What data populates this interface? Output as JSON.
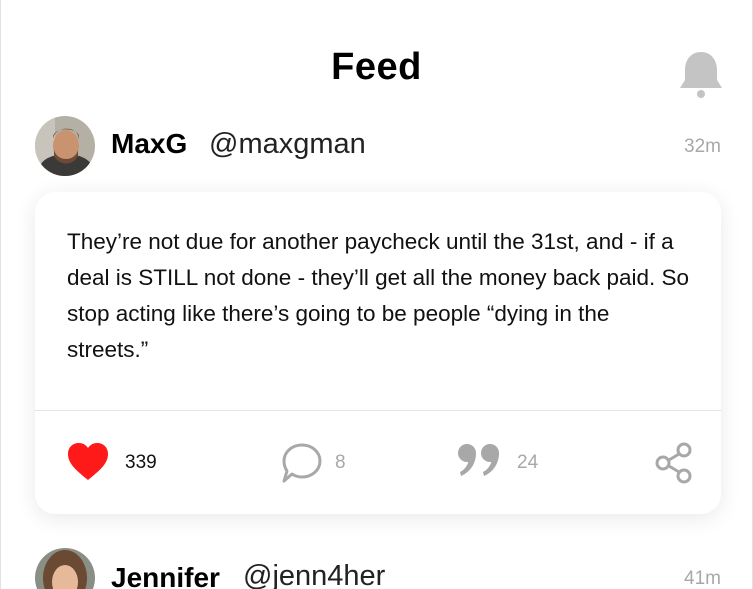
{
  "header": {
    "title": "Feed",
    "notification_icon": "bell-icon"
  },
  "colors": {
    "like": "#ff1a1a",
    "icon_grey": "#a8a8a8"
  },
  "posts": [
    {
      "name": "MaxG",
      "handle": "@maxgman",
      "time": "32m",
      "text": "They’re not due for another paycheck until the 31st, and  - if a deal is STILL not done - they’ll get all the money back paid. So stop acting like there’s going to be people “dying in the streets.”",
      "likes": "339",
      "comments": "8",
      "quotes": "24"
    },
    {
      "name": "Jennifer",
      "handle": "@jenn4her",
      "time": "41m"
    }
  ]
}
